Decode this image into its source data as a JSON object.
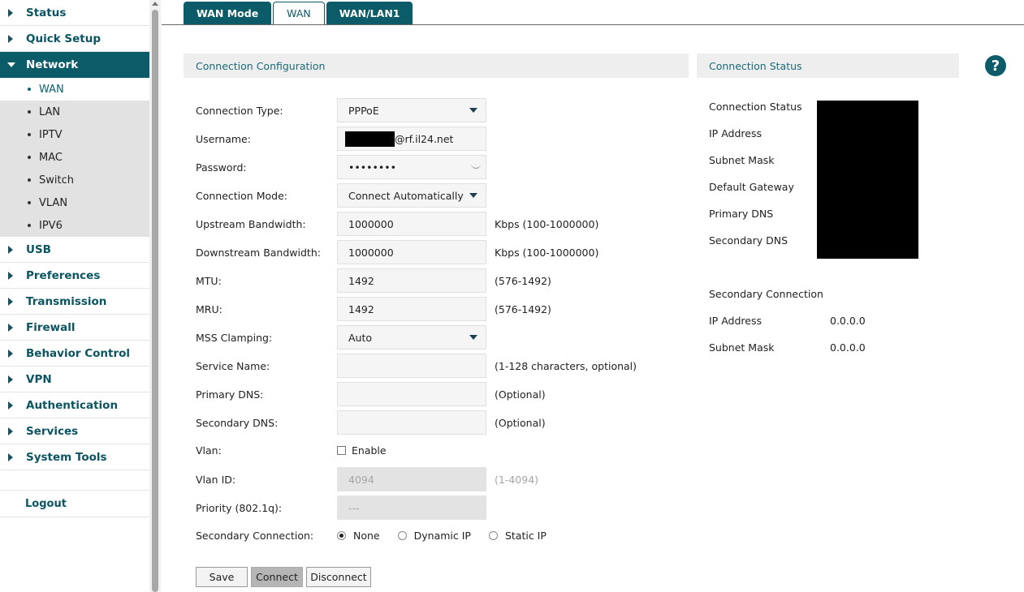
{
  "sidebar": {
    "items": [
      {
        "label": "Status"
      },
      {
        "label": "Quick Setup"
      },
      {
        "label": "Network"
      },
      {
        "label": "USB"
      },
      {
        "label": "Preferences"
      },
      {
        "label": "Transmission"
      },
      {
        "label": "Firewall"
      },
      {
        "label": "Behavior Control"
      },
      {
        "label": "VPN"
      },
      {
        "label": "Authentication"
      },
      {
        "label": "Services"
      },
      {
        "label": "System Tools"
      }
    ],
    "network_sub": [
      "WAN",
      "LAN",
      "IPTV",
      "MAC",
      "Switch",
      "VLAN",
      "IPV6"
    ],
    "logout": "Logout"
  },
  "tabs": [
    "WAN Mode",
    "WAN",
    "WAN/LAN1"
  ],
  "config": {
    "header": "Connection Configuration",
    "connection_type": {
      "label": "Connection Type:",
      "value": "PPPoE"
    },
    "username": {
      "label": "Username:",
      "value_suffix": "@rf.il24.net"
    },
    "password": {
      "label": "Password:",
      "value": "••••••••"
    },
    "connection_mode": {
      "label": "Connection Mode:",
      "value": "Connect Automatically"
    },
    "upstream": {
      "label": "Upstream Bandwidth:",
      "value": "1000000",
      "hint": "Kbps (100-1000000)"
    },
    "downstream": {
      "label": "Downstream Bandwidth:",
      "value": "1000000",
      "hint": "Kbps (100-1000000)"
    },
    "mtu": {
      "label": "MTU:",
      "value": "1492",
      "hint": "(576-1492)"
    },
    "mru": {
      "label": "MRU:",
      "value": "1492",
      "hint": "(576-1492)"
    },
    "mss": {
      "label": "MSS Clamping:",
      "value": "Auto"
    },
    "service_name": {
      "label": "Service Name:",
      "value": "",
      "hint": "(1-128 characters, optional)"
    },
    "primary_dns": {
      "label": "Primary DNS:",
      "value": "",
      "hint": "(Optional)"
    },
    "secondary_dns": {
      "label": "Secondary DNS:",
      "value": "",
      "hint": "(Optional)"
    },
    "vlan": {
      "label": "Vlan:",
      "checkbox": "Enable"
    },
    "vlan_id": {
      "label": "Vlan ID:",
      "value": "4094",
      "hint": "(1-4094)"
    },
    "priority": {
      "label": "Priority (802.1q):",
      "value": "---"
    },
    "secondary_connection": {
      "label": "Secondary Connection:",
      "options": [
        "None",
        "Dynamic IP",
        "Static IP"
      ],
      "selected": "None"
    },
    "buttons": {
      "save": "Save",
      "connect": "Connect",
      "disconnect": "Disconnect"
    }
  },
  "status": {
    "header": "Connection Status",
    "labels": [
      "Connection Status",
      "IP Address",
      "Subnet Mask",
      "Default Gateway",
      "Primary DNS",
      "Secondary DNS"
    ],
    "secondary_title": "Secondary Connection",
    "secondary": [
      {
        "label": "IP Address",
        "value": "0.0.0.0"
      },
      {
        "label": "Subnet Mask",
        "value": "0.0.0.0"
      }
    ]
  },
  "help_icon": "?"
}
